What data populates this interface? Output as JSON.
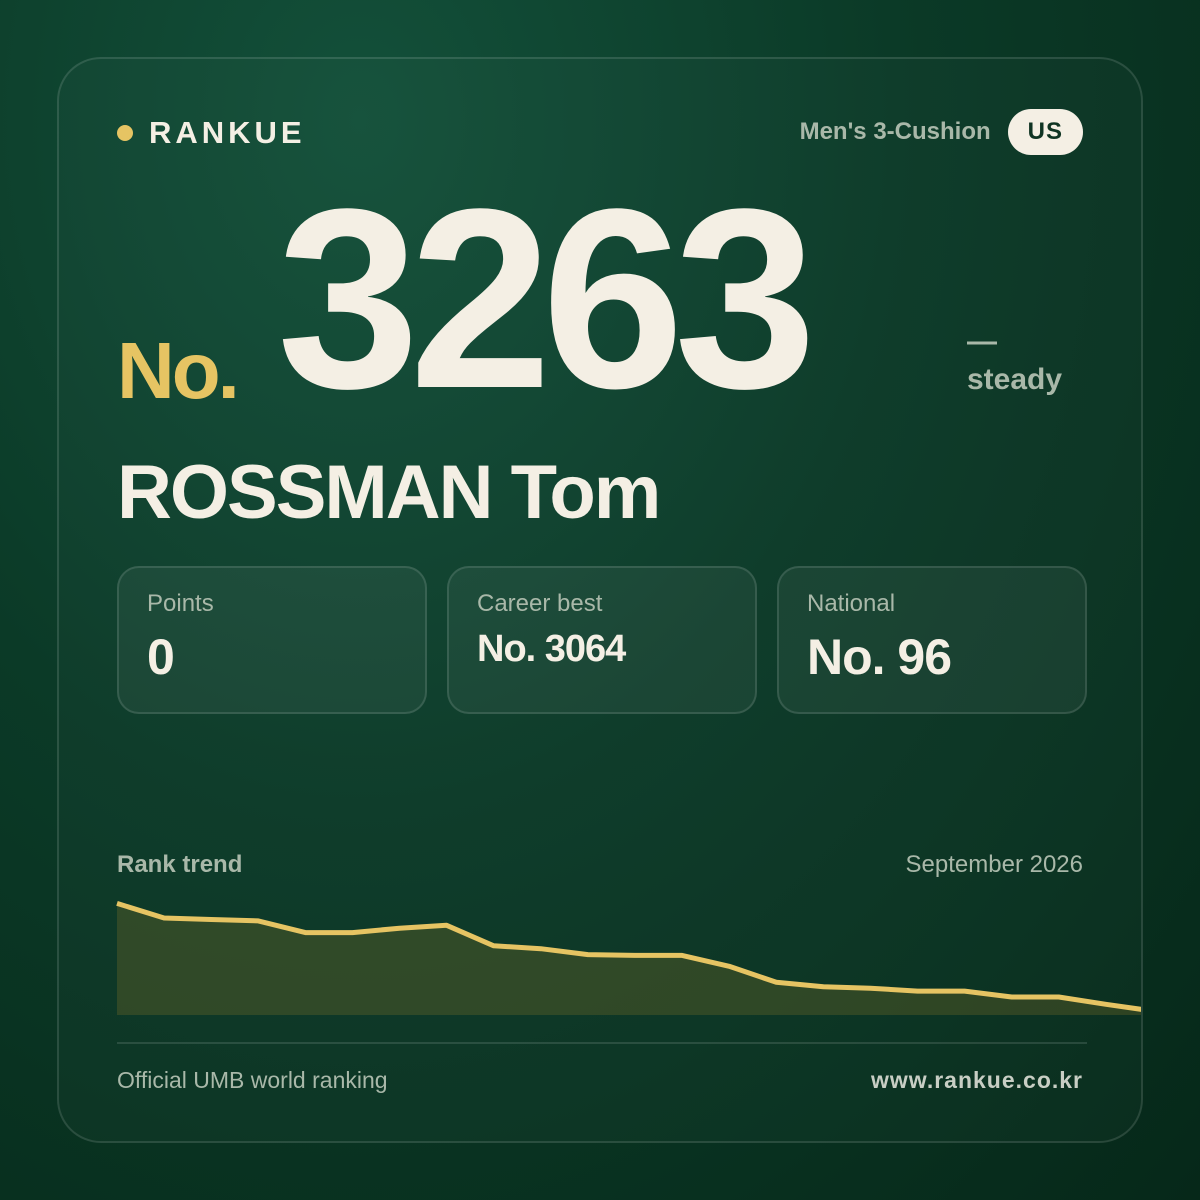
{
  "brand": {
    "name": "RANKUE"
  },
  "header": {
    "category": "Men's 3-Cushion",
    "country": "US"
  },
  "rank": {
    "prefix": "No.",
    "number": "3263",
    "trend_symbol": "—",
    "trend_label": "steady"
  },
  "player": {
    "name": "ROSSMAN Tom"
  },
  "stats": [
    {
      "label": "Points",
      "value": "0"
    },
    {
      "label": "Career best",
      "value": "No. 3064"
    },
    {
      "label": "National",
      "value": "No. 96"
    }
  ],
  "trend": {
    "title": "Rank trend",
    "date": "September 2026"
  },
  "footer": {
    "source": "Official UMB world ranking",
    "url": "www.rankue.co.kr"
  },
  "colors": {
    "accent": "#e6c463",
    "background": "#0b3a27",
    "text": "#f4efe4",
    "muted": "#a9b8a9"
  },
  "chart_data": {
    "type": "area",
    "x": [
      1,
      2,
      3,
      4,
      5,
      6,
      7,
      8,
      9,
      10,
      11,
      12,
      13,
      14,
      15,
      16,
      17,
      18,
      19,
      20,
      21,
      22,
      23
    ],
    "values": [
      2895,
      2945,
      2950,
      2955,
      2995,
      2995,
      2980,
      2970,
      3040,
      3050,
      3070,
      3073,
      3073,
      3110,
      3165,
      3180,
      3185,
      3195,
      3195,
      3215,
      3215,
      3240,
      3263
    ],
    "inverted_y": true,
    "ylim": [
      2880,
      3263
    ],
    "title": "Rank trend",
    "xlabel": "",
    "ylabel": "",
    "grid": false,
    "color": "#e6c463"
  }
}
